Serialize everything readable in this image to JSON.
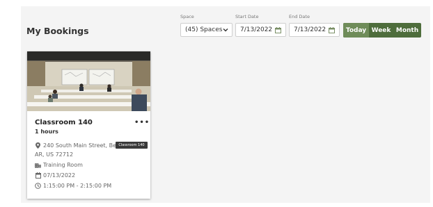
{
  "page": {
    "title": "My Bookings"
  },
  "filters": {
    "space": {
      "label": "Space",
      "value": "(45) Spaces"
    },
    "start_date": {
      "label": "Start Date",
      "value": "7/13/2022"
    },
    "end_date": {
      "label": "End Date",
      "value": "7/13/2022"
    },
    "view_toggle": {
      "today": "Today",
      "week": "Week",
      "month": "Month",
      "active": "Today"
    }
  },
  "booking": {
    "title": "Classroom 140",
    "duration": "1 hours",
    "address_line1": "240 South Main Street, Ben",
    "address_line2": "AR, US 72712",
    "room_type": "Training Room",
    "date": "07/13/2022",
    "time": "1:15:00 PM - 2:15:00 PM",
    "menu": "•••"
  },
  "tooltip": {
    "text": "Classroom 140"
  },
  "colors": {
    "accent": "#4e6d3c",
    "accent_active": "#6f8c59",
    "panel": "#f4f4f4"
  },
  "icons": [
    "chevron-down-icon",
    "calendar-icon",
    "map-pin-icon",
    "building-icon",
    "clock-icon",
    "more-options-icon"
  ]
}
